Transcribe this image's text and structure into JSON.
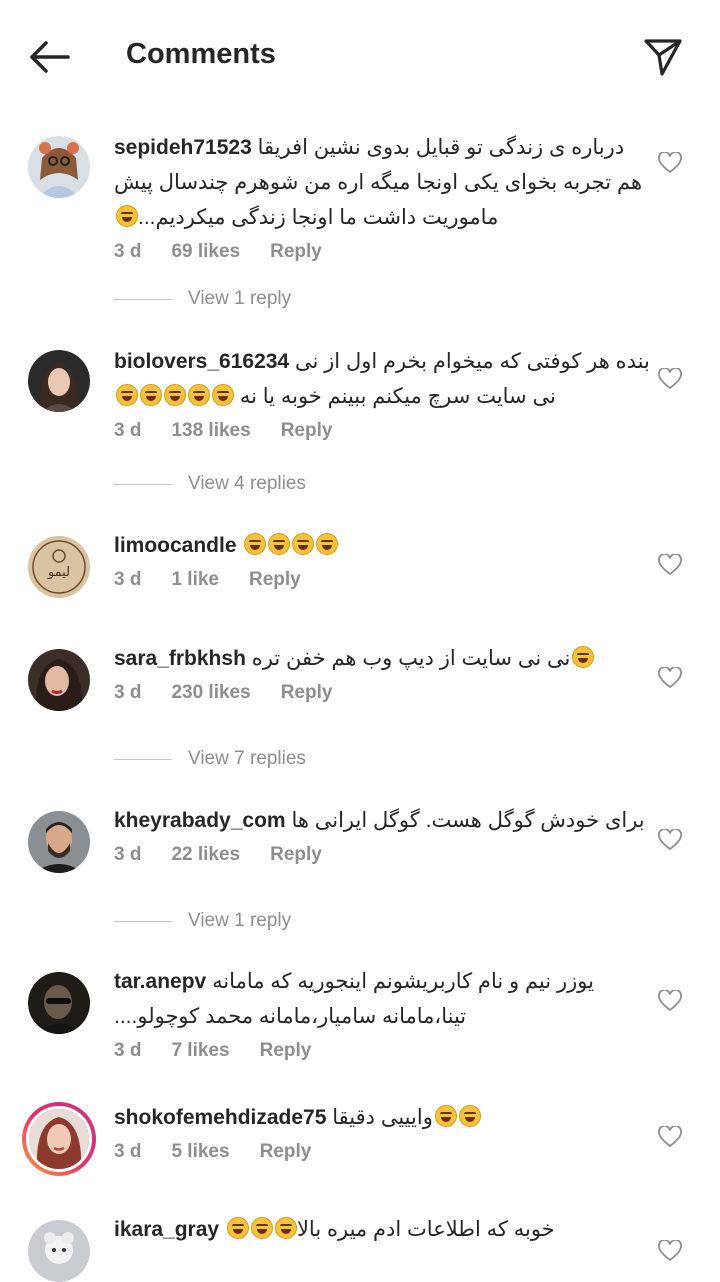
{
  "header": {
    "title": "Comments"
  },
  "comments": [
    {
      "user": "sepideh71523",
      "lines": [
        "درباره ی زندگی تو قبایل بدوی نشین افریقا",
        "هم تجربه بخوای یکی اونجا میگه اره من شوهرم چندسال پیش",
        "...ماموریت داشت ما اونجا زندگی میکردیم"
      ],
      "time": "3 d",
      "likes": "69 likes",
      "reply": "Reply",
      "view_replies": "View 1 reply"
    },
    {
      "user": "biolovers_616234",
      "lines": [
        "بنده هر کوفتی  که میخوام بخرم اول از نی",
        "نی سایت سرچ میکنم ببینم خوبه یا نه"
      ],
      "time": "3 d",
      "likes": "138 likes",
      "reply": "Reply",
      "view_replies": "View 4 replies"
    },
    {
      "user": "limoocandle",
      "lines": [
        ""
      ],
      "time": "3 d",
      "likes": "1 like",
      "reply": "Reply"
    },
    {
      "user": "sara_frbkhsh",
      "lines": [
        "نی نی سایت از دیپ وب هم خفن تره"
      ],
      "time": "3 d",
      "likes": "230 likes",
      "reply": "Reply",
      "view_replies": "View 7 replies"
    },
    {
      "user": "kheyrabady_com",
      "lines": [
        "برای خودش گوگل هست. گوگل ایرانی ها"
      ],
      "time": "3 d",
      "likes": "22 likes",
      "reply": "Reply",
      "view_replies": "View 1 reply"
    },
    {
      "user": "tar.anepv",
      "lines": [
        "یوزر نیم و نام کاربریشونم اینجوریه که مامانه",
        "....تینا،مامانه سامیار،مامانه محمد کوچولو"
      ],
      "time": "3 d",
      "likes": "7 likes",
      "reply": "Reply"
    },
    {
      "user": "shokofemehdizade75",
      "lines": [
        "وایییی دقیقا"
      ],
      "time": "3 d",
      "likes": "5 likes",
      "reply": "Reply"
    },
    {
      "user": "ikara_gray",
      "lines": [
        "خوبه که اطلاعات ادم میره بالا"
      ]
    }
  ],
  "colors": {
    "text": "#262626",
    "secondary": "#8e8e8e",
    "divider": "#c7c7c7",
    "emoji": "#f7c23a"
  }
}
